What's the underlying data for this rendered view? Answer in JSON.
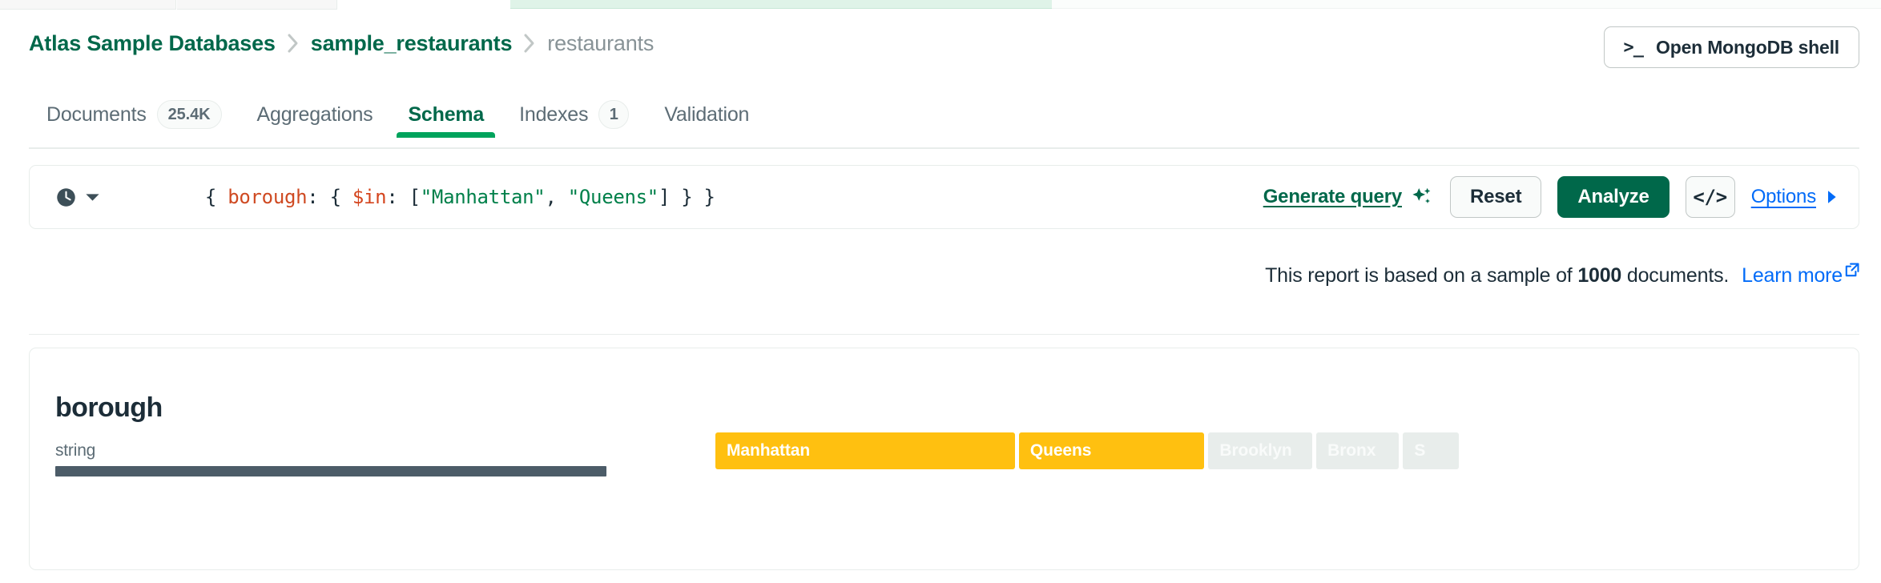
{
  "header": {
    "breadcrumb": [
      {
        "label": "Atlas Sample Databases",
        "type": "link"
      },
      {
        "label": "sample_restaurants",
        "type": "link"
      },
      {
        "label": "restaurants",
        "type": "current"
      }
    ],
    "shell_button": {
      "label": "Open MongoDB shell",
      "icon": ">_"
    }
  },
  "tabs": [
    {
      "label": "Documents",
      "badge": "25.4K",
      "active": false
    },
    {
      "label": "Aggregations",
      "badge": null,
      "active": false
    },
    {
      "label": "Schema",
      "badge": null,
      "active": true
    },
    {
      "label": "Indexes",
      "badge": "1",
      "active": false
    },
    {
      "label": "Validation",
      "badge": null,
      "active": false
    }
  ],
  "query_bar": {
    "history_icon": "clock-icon",
    "history_caret": "chevron-down-icon",
    "query": {
      "full_text": "{ borough: { $in: [\"Manhattan\", \"Queens\"] } }",
      "tokens": [
        {
          "text": "{ ",
          "kind": "punct"
        },
        {
          "text": "borough",
          "kind": "key"
        },
        {
          "text": ": { ",
          "kind": "punct"
        },
        {
          "text": "$in",
          "kind": "op"
        },
        {
          "text": ": [",
          "kind": "punct"
        },
        {
          "text": "\"Manhattan\"",
          "kind": "str"
        },
        {
          "text": ", ",
          "kind": "punct"
        },
        {
          "text": "\"Queens\"",
          "kind": "str"
        },
        {
          "text": "] } }",
          "kind": "punct"
        }
      ]
    },
    "generate_query_label": "Generate query",
    "generate_query_icon": "sparkle-icon",
    "reset_label": "Reset",
    "analyze_label": "Analyze",
    "export_code_label": "</>",
    "options_label": "Options",
    "options_caret": "caret-right-icon"
  },
  "sample_note": {
    "prefix": "This report is based on a sample of",
    "count": "1000",
    "suffix": "documents.",
    "learn_more_label": "Learn more",
    "learn_more_icon": "external-link-icon"
  },
  "schema": {
    "field_name": "borough",
    "field_type": "string",
    "values": [
      {
        "label": "Manhattan",
        "selected": true,
        "width_pct": 26.8
      },
      {
        "label": "Queens",
        "selected": true,
        "width_pct": 16.6
      },
      {
        "label": "Brooklyn",
        "selected": false,
        "width_pct": 9.3
      },
      {
        "label": "Bronx",
        "selected": false,
        "width_pct": 7.4
      },
      {
        "label": "S",
        "selected": false,
        "width_pct": 5.0
      }
    ]
  },
  "colors": {
    "brand_green": "#00684a",
    "accent_green": "#00a35c",
    "link_blue": "#016bf8",
    "bar_selected": "#ffc010",
    "bar_unselected": "#e8edeb",
    "type_bar": "#4c5c68",
    "string_token": "#00804a",
    "key_token": "#cf4a22"
  }
}
